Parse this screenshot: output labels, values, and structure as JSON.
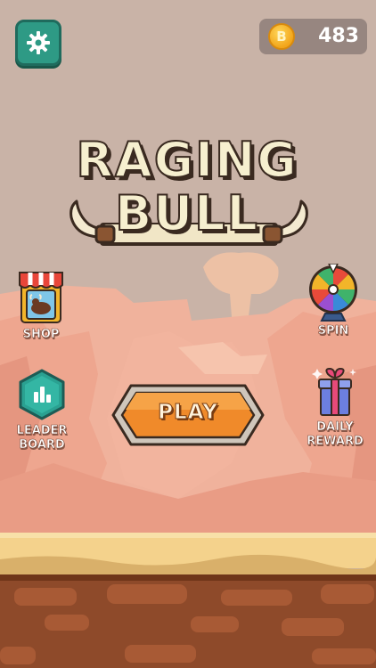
{
  "coins": {
    "count": "483",
    "symbol": "B"
  },
  "logo": {
    "line1": "RAGING",
    "line2": "BULL"
  },
  "menu": {
    "shop": "SHOP",
    "spin": "SPIN",
    "leaderboard": [
      "LEADER",
      "BOARD"
    ],
    "daily_reward": [
      "DAILY",
      "REWARD"
    ]
  },
  "play": {
    "label": "PLAY"
  },
  "colors": {
    "sky": "#c9b3a7",
    "rock": "#eca38f",
    "sand": "#f4d28c",
    "dirt": "#8e4a2a",
    "accent_orange": "#f08a2a",
    "settings_teal": "#2e9a85"
  },
  "icons": [
    "gear-icon",
    "coin-icon",
    "shop-icon",
    "prize-wheel-icon",
    "leaderboard-icon",
    "gift-icon"
  ]
}
